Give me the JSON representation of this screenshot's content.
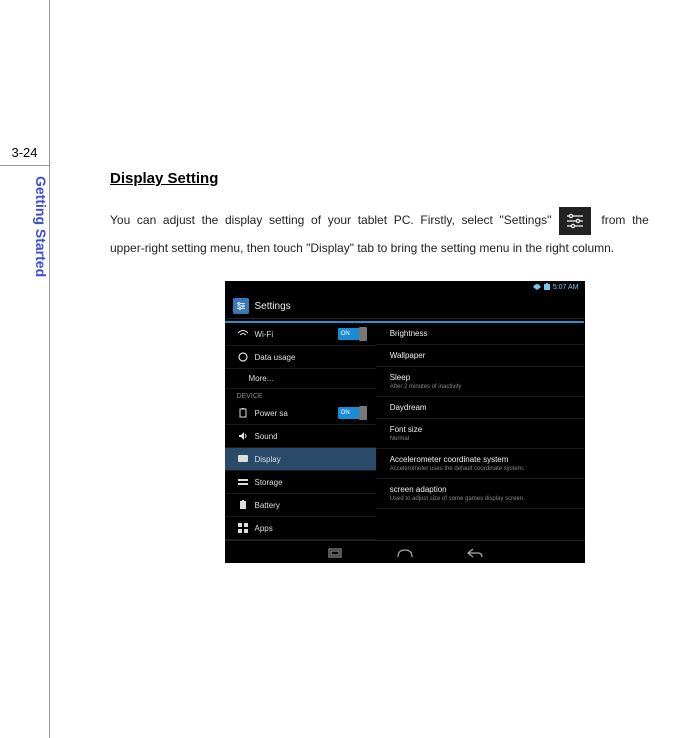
{
  "page_number": "3-24",
  "section_tab": "Getting Started",
  "heading": "Display Setting ",
  "body_part1": "You  can  adjust  the  display  setting  of  your  tablet  PC.  Firstly,  select  \"Settings\"",
  "body_part2": " from  the ",
  "body_part3": "upper-right setting menu, then touch \"Display\" tab to bring the setting menu in the right column.",
  "screenshot": {
    "statusbar": {
      "wifi": "wifi",
      "time": "5:07 AM"
    },
    "title": "Settings",
    "left": {
      "wifi": "Wi-Fi",
      "data_usage": "Data usage",
      "more": "More...",
      "device_header": "DEVICE",
      "power_save": "Power sa",
      "sound": "Sound",
      "display": "Display",
      "storage": "Storage",
      "battery": "Battery",
      "apps": "Apps",
      "toggle_on": "ON"
    },
    "right": {
      "brightness": "Brightness",
      "wallpaper": "Wallpaper",
      "sleep": "Sleep",
      "sleep_sub": "After 2 minutes of inactivity",
      "daydream": "Daydream",
      "font_size": "Font size",
      "font_size_sub": "Normal",
      "accel": "Accelerometer coordinate system",
      "accel_sub": "Accelerometer uses the default coordinate system.",
      "adaption": "screen adaption",
      "adaption_sub": "Used to adjust size of some games display screen."
    }
  }
}
